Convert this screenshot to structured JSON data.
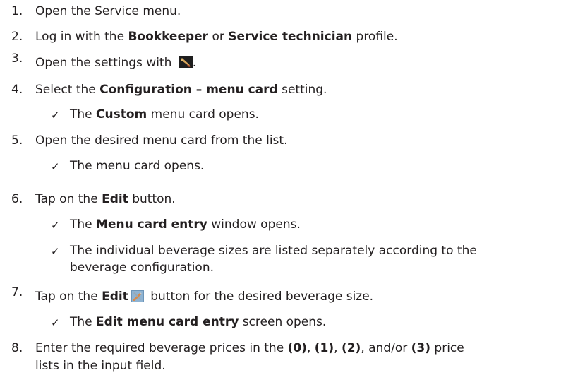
{
  "steps": [
    {
      "num": "1.",
      "parts": [
        "Open the Service menu."
      ]
    },
    {
      "num": "2.",
      "parts": [
        "Log in with the ",
        "Bookkeeper",
        " or ",
        "Service technician",
        " profile."
      ]
    },
    {
      "num": "3.",
      "parts": [
        "Open the settings with ",
        "."
      ]
    },
    {
      "num": "4.",
      "parts": [
        "Select the ",
        "Configuration – menu card",
        " setting."
      ]
    },
    {
      "num": "5.",
      "parts": [
        "Open the desired menu card from the list."
      ]
    },
    {
      "num": "6.",
      "parts": [
        "Tap on the ",
        "Edit",
        " button."
      ]
    },
    {
      "num": "7.",
      "parts": [
        "Tap on the ",
        "Edit",
        " button for the desired beverage size."
      ]
    },
    {
      "num": "8.",
      "parts": [
        "Enter the required beverage prices in the ",
        "(0)",
        ", ",
        "(1)",
        ", ",
        "(2)",
        ", and/or ",
        "(3)",
        " price",
        "lists in the input field."
      ]
    }
  ],
  "results": [
    {
      "check": "✓",
      "parts": [
        "The ",
        "Custom",
        " menu card opens."
      ]
    },
    {
      "check": "✓",
      "parts": [
        "The menu card opens."
      ]
    },
    {
      "check": "✓",
      "parts": [
        "The ",
        "Menu card entry",
        " window opens."
      ]
    },
    {
      "check": "✓",
      "parts": [
        "The individual beverage sizes are listed separately according to the",
        "beverage configuration."
      ]
    },
    {
      "check": "✓",
      "parts": [
        "The ",
        "Edit menu card entry",
        " screen opens."
      ]
    }
  ],
  "icons": {
    "settings": "wrench-icon",
    "edit": "edit-icon"
  }
}
